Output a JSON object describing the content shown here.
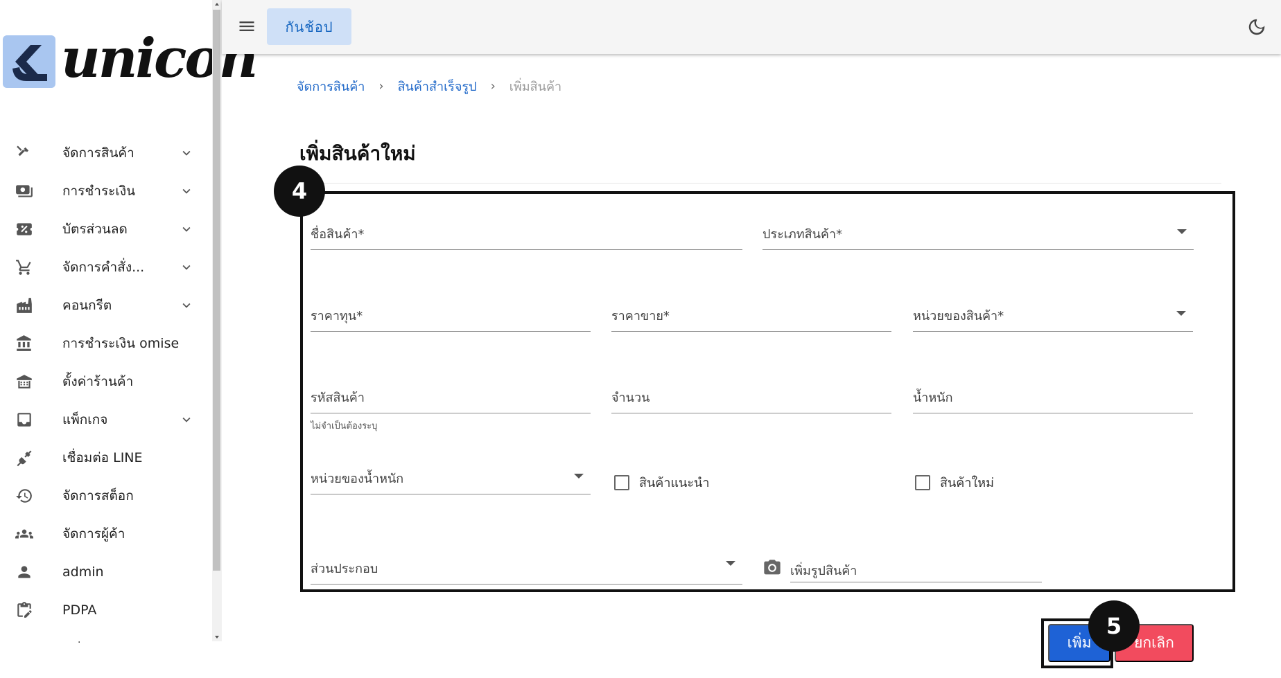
{
  "brand": {
    "logo_text": "unicon"
  },
  "sidebar": {
    "items": [
      {
        "label": "จัดการสินค้า",
        "icon": "tools-icon",
        "expandable": true
      },
      {
        "label": "การชำระเงิน",
        "icon": "payments-icon",
        "expandable": true
      },
      {
        "label": "บัตรส่วนลด",
        "icon": "discount-icon",
        "expandable": true
      },
      {
        "label": "จัดการคำสั่ง...",
        "icon": "cart-icon",
        "expandable": true
      },
      {
        "label": "คอนกรีต",
        "icon": "factory-icon",
        "expandable": true
      },
      {
        "label": "การชำระเงิน omise",
        "icon": "bank-icon",
        "expandable": false
      },
      {
        "label": "ตั้งค่าร้านค้า",
        "icon": "store-icon",
        "expandable": false
      },
      {
        "label": "แพ็กเกจ",
        "icon": "package-icon",
        "expandable": true
      },
      {
        "label": "เชื่อมต่อ LINE",
        "icon": "plug-icon",
        "expandable": false
      },
      {
        "label": "จัดการสต็อก",
        "icon": "stock-history-icon",
        "expandable": false
      },
      {
        "label": "จัดการผู้ค้า",
        "icon": "group-icon",
        "expandable": false
      },
      {
        "label": "admin",
        "icon": "person-icon",
        "expandable": false
      },
      {
        "label": "PDPA",
        "icon": "clipboard-edit-icon",
        "expandable": false
      }
    ],
    "more_text": "·"
  },
  "topbar": {
    "shop_button": "กันช้อป"
  },
  "breadcrumb": {
    "items": [
      "จัดการสินค้า",
      "สินค้าสำเร็จรูป"
    ],
    "current": "เพิ่มสินค้า",
    "separator": "›"
  },
  "page": {
    "title": "เพิ่มสินค้าใหม่"
  },
  "badges": {
    "form": "4",
    "add": "5"
  },
  "form": {
    "product_name": "ชื่อสินค้า*",
    "product_type": "ประเภทสินค้า*",
    "cost_price": "ราคาทุน*",
    "sell_price": "ราคาขาย*",
    "product_unit": "หน่วยของสินค้า*",
    "product_code": "รหัสสินค้า",
    "product_code_hint": "ไม่จำเป็นต้องระบุ",
    "quantity": "จำนวน",
    "weight": "น้ำหนัก",
    "weight_unit": "หน่วยของน้ำหนัก",
    "recommended": "สินค้าแนะนำ",
    "new_product": "สินค้าใหม่",
    "ingredients": "ส่วนประกอบ",
    "add_image": "เพิ่มรูปสินค้า"
  },
  "actions": {
    "add": "เพิ่ม",
    "cancel": "ยกเลิก"
  },
  "colors": {
    "primary": "#1e62d6",
    "danger": "#f24b5e",
    "link": "#1e67c8",
    "shop_bg": "#cfe0f7"
  }
}
